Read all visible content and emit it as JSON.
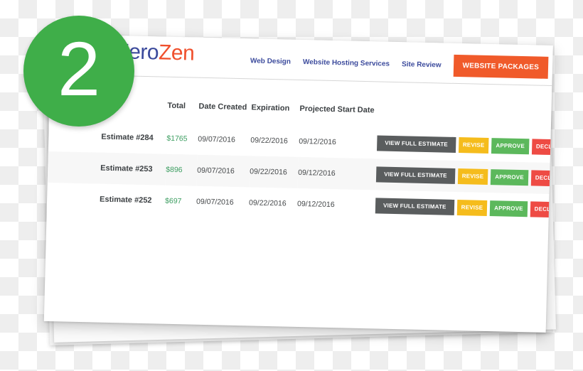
{
  "badge": {
    "number": "2"
  },
  "brand": {
    "name_part_1": "Zero",
    "name_part_2": "Zen",
    "swoosh_icon": "swoosh-icon",
    "color_primary": "#3b4a9c",
    "color_accent": "#f0502d"
  },
  "nav": {
    "links": [
      {
        "label": "Web Design"
      },
      {
        "label": "Website Hosting Services"
      },
      {
        "label": "Site Review"
      }
    ],
    "cta": {
      "label": "WEBSITE PACKAGES",
      "color": "#f05a2a"
    }
  },
  "table": {
    "headers": {
      "id": "",
      "total": "Total",
      "date_created": "Date Created",
      "expiration": "Expiration",
      "projected_start_date": "Projected Start Date",
      "actions": ""
    },
    "rows": [
      {
        "id": "Estimate #284",
        "total": "$1765",
        "date_created": "09/07/2016",
        "expiration": "09/22/2016",
        "projected_start_date": "09/12/2016"
      },
      {
        "id": "Estimate #253",
        "total": "$896",
        "date_created": "09/07/2016",
        "expiration": "09/22/2016",
        "projected_start_date": "09/12/2016"
      },
      {
        "id": "Estimate #252",
        "total": "$697",
        "date_created": "09/07/2016",
        "expiration": "09/22/2016",
        "projected_start_date": "09/12/2016"
      }
    ],
    "buttons": {
      "view": "VIEW FULL ESTIMATE",
      "revise": "REVISE",
      "approve": "APPROVE",
      "decline": "DECLINE"
    },
    "colors": {
      "view": "#5a5d5e",
      "revise": "#f5bc1c",
      "approve": "#5cb85c",
      "decline": "#ee4b44",
      "total_text": "#3e9e62"
    }
  }
}
